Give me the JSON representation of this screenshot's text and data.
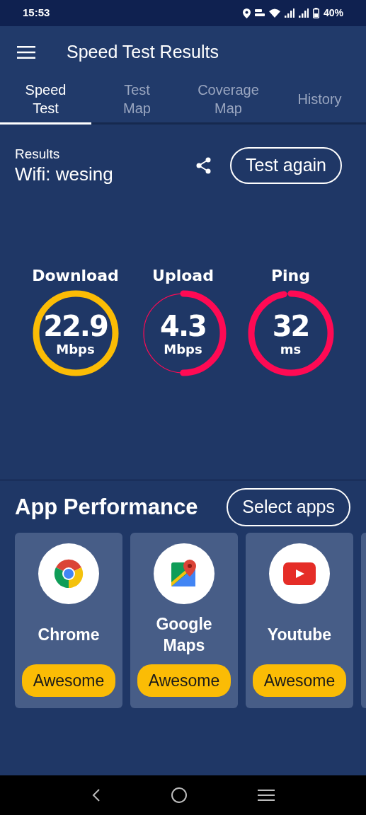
{
  "status_bar": {
    "time": "15:53",
    "battery": "40%"
  },
  "app_bar": {
    "title": "Speed Test Results"
  },
  "tabs": [
    {
      "label": "Speed Test",
      "selected": true
    },
    {
      "label": "Test Map",
      "selected": false
    },
    {
      "label": "Coverage Map",
      "selected": false
    },
    {
      "label": "History",
      "selected": false
    }
  ],
  "results": {
    "heading": "Results",
    "network": "Wifi: wesing",
    "button": "Test again"
  },
  "gauges": [
    {
      "label": "Download",
      "value": "22.9",
      "unit": "Mbps",
      "color": "#fbbc05"
    },
    {
      "label": "Upload",
      "value": "4.3",
      "unit": "Mbps",
      "color": "#ff0a54"
    },
    {
      "label": "Ping",
      "value": "32",
      "unit": "ms",
      "color": "#ff0a54"
    }
  ],
  "app_performance": {
    "title": "App Performance",
    "button": "Select apps",
    "apps": [
      {
        "kind": "chrome",
        "name": "Chrome",
        "rating": "Awesome"
      },
      {
        "kind": "maps",
        "name": "Google Maps",
        "rating": "Awesome"
      },
      {
        "kind": "youtube",
        "name": "Youtube",
        "rating": "Awesome"
      }
    ]
  }
}
